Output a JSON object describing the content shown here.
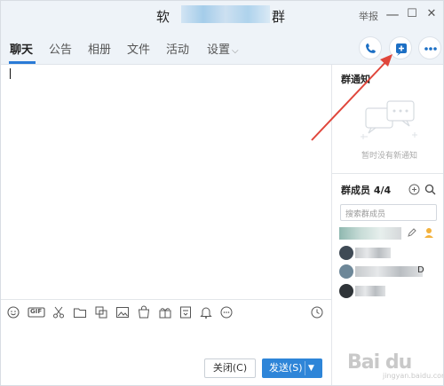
{
  "window": {
    "title_prefix": "软",
    "title_suffix": "群",
    "report_label": "举报",
    "minimize": "—",
    "maximize": "☐",
    "close": "✕"
  },
  "tabs": [
    {
      "label": "聊天",
      "active": true
    },
    {
      "label": "公告"
    },
    {
      "label": "相册"
    },
    {
      "label": "文件"
    },
    {
      "label": "活动"
    },
    {
      "label": "设置"
    }
  ],
  "header_actions": [
    "phone-icon",
    "add-icon",
    "more-icon"
  ],
  "toolbar_icons": [
    "emoji-icon",
    "gif-icon",
    "scissors-icon",
    "folder-icon",
    "screenshot-icon",
    "image-icon",
    "bag-icon",
    "gift-icon",
    "vote-icon",
    "bell-icon",
    "more-circle-icon",
    "history-icon"
  ],
  "gif_label": "GIF",
  "buttons": {
    "close_label": "关闭(C)",
    "send_label": "发送(S)"
  },
  "right_panel": {
    "notice_title": "群通知",
    "notice_empty": "暂时没有新通知",
    "members_title": "群成员 4/4",
    "member_search_placeholder": "搜索群成员",
    "members_visible_suffix": "D"
  },
  "watermark": {
    "text": "Bai du",
    "sub": "jingyan.baidu.com"
  },
  "colors": {
    "accent": "#2e85d8",
    "annotation": "#e0463b"
  }
}
